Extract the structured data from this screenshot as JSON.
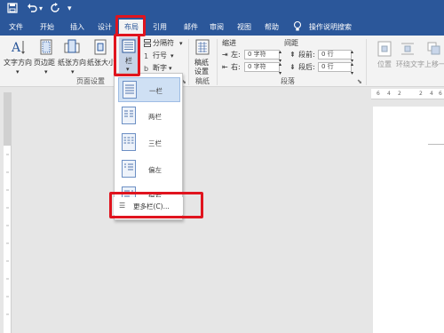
{
  "title_bar": {
    "save_icon": "save-icon",
    "undo_icon": "undo-icon",
    "redo_icon": "redo-icon",
    "customize_icon": "customize-quick-access-icon"
  },
  "tabs": [
    {
      "label": "文件"
    },
    {
      "label": "开始"
    },
    {
      "label": "插入"
    },
    {
      "label": "设计"
    },
    {
      "label": "布局",
      "active": true
    },
    {
      "label": "引用"
    },
    {
      "label": "邮件"
    },
    {
      "label": "审阅"
    },
    {
      "label": "视图"
    },
    {
      "label": "帮助"
    }
  ],
  "tell_me": {
    "icon": "lightbulb-icon",
    "label": "操作说明搜索"
  },
  "ribbon": {
    "page_setup": {
      "text_direction": "文字方向",
      "margins": "页边距",
      "orientation": "纸张方向",
      "size": "纸张大小",
      "columns": "栏",
      "breaks": "分隔符",
      "line_numbers": "行号",
      "hyphenation": "断字",
      "group_label": "页面设置"
    },
    "draft": {
      "label_1": "稿纸",
      "label_2": "设置",
      "group_label": "稿纸"
    },
    "paragraph": {
      "indent_label": "缩进",
      "spacing_label": "间距",
      "left_label": "左:",
      "right_label": "右:",
      "before_label": "段前:",
      "after_label": "段后:",
      "left_value": "0 字符",
      "right_value": "0 字符",
      "before_value": "0 行",
      "after_value": "0 行",
      "group_label": "段落"
    },
    "arrange": {
      "position": "位置",
      "wrap_text": "环绕文字",
      "bring_forward": "上移一"
    }
  },
  "columns_menu": {
    "items": [
      {
        "label": "一栏"
      },
      {
        "label": "两栏"
      },
      {
        "label": "三栏"
      },
      {
        "label": "偏左"
      },
      {
        "label": "偏右"
      }
    ],
    "more": "更多栏(C)..."
  },
  "ruler": {
    "ticks": [
      "6",
      "4",
      "2",
      "",
      "2",
      "4",
      "6"
    ]
  },
  "colors": {
    "brand": "#2b579a",
    "highlight": "#e0141e",
    "ribbon": "#f3f3f3"
  }
}
